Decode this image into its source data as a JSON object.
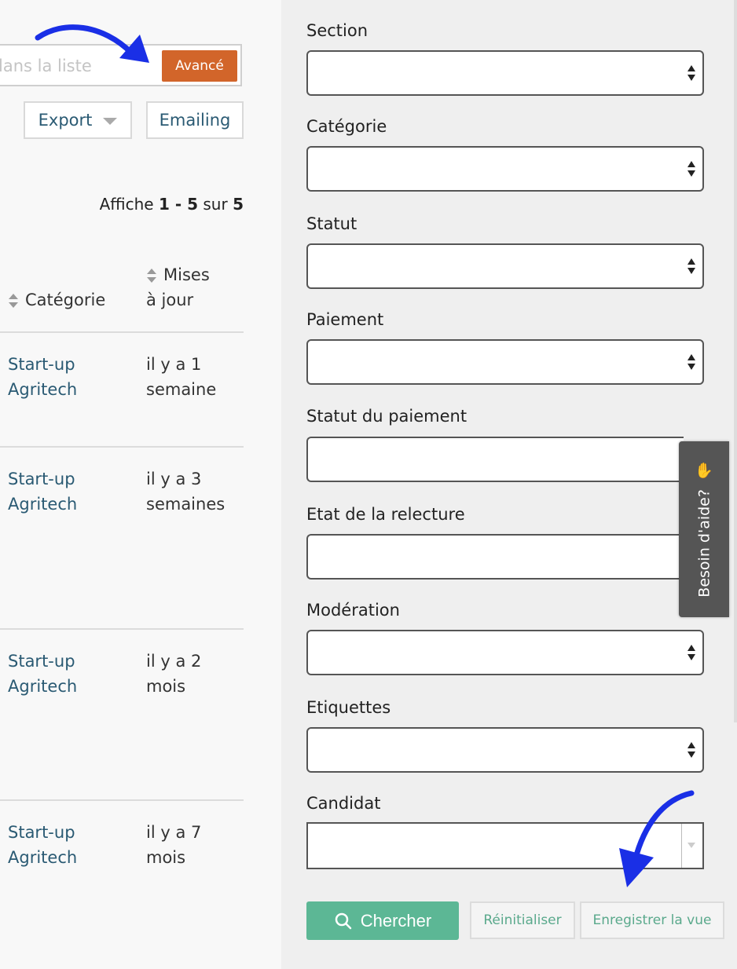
{
  "search": {
    "placeholder_fragment": "lans la liste",
    "advanced_label": "Avancé"
  },
  "toolbar": {
    "export_label": "Export",
    "emailing_label": "Emailing"
  },
  "results": {
    "prefix": "Affiche",
    "range": "1 - 5",
    "sur": "sur",
    "total": "5"
  },
  "table": {
    "headers": {
      "categorie": "Catégorie",
      "maj_line1": "Mises",
      "maj_line2": "à jour"
    },
    "rows": [
      {
        "cat1": "Start-up",
        "cat2": "Agritech",
        "upd1": "il y a 1",
        "upd2": "semaine"
      },
      {
        "cat1": "Start-up",
        "cat2": "Agritech",
        "upd1": "il y a 3",
        "upd2": "semaines"
      },
      {
        "cat1": "Start-up",
        "cat2": "Agritech",
        "upd1": "il y a 2",
        "upd2": "mois"
      },
      {
        "cat1": "Start-up",
        "cat2": "Agritech",
        "upd1": "il y a 7",
        "upd2": "mois"
      }
    ]
  },
  "filters": {
    "section": "Section",
    "categorie": "Catégorie",
    "statut": "Statut",
    "paiement": "Paiement",
    "statut_paiement": "Statut du paiement",
    "etat_relecture": "Etat de la relecture",
    "moderation": "Modération",
    "etiquettes": "Etiquettes",
    "candidat": "Candidat"
  },
  "actions": {
    "chercher": "Chercher",
    "reinitialiser": "Réinitialiser",
    "enregistrer": "Enregistrer la vue"
  },
  "help": {
    "label": "Besoin d'aide?"
  },
  "colors": {
    "accent_orange": "#d2652a",
    "green": "#5cb795",
    "link": "#2a5a73",
    "annotation_arrow": "#1a2fe6"
  }
}
